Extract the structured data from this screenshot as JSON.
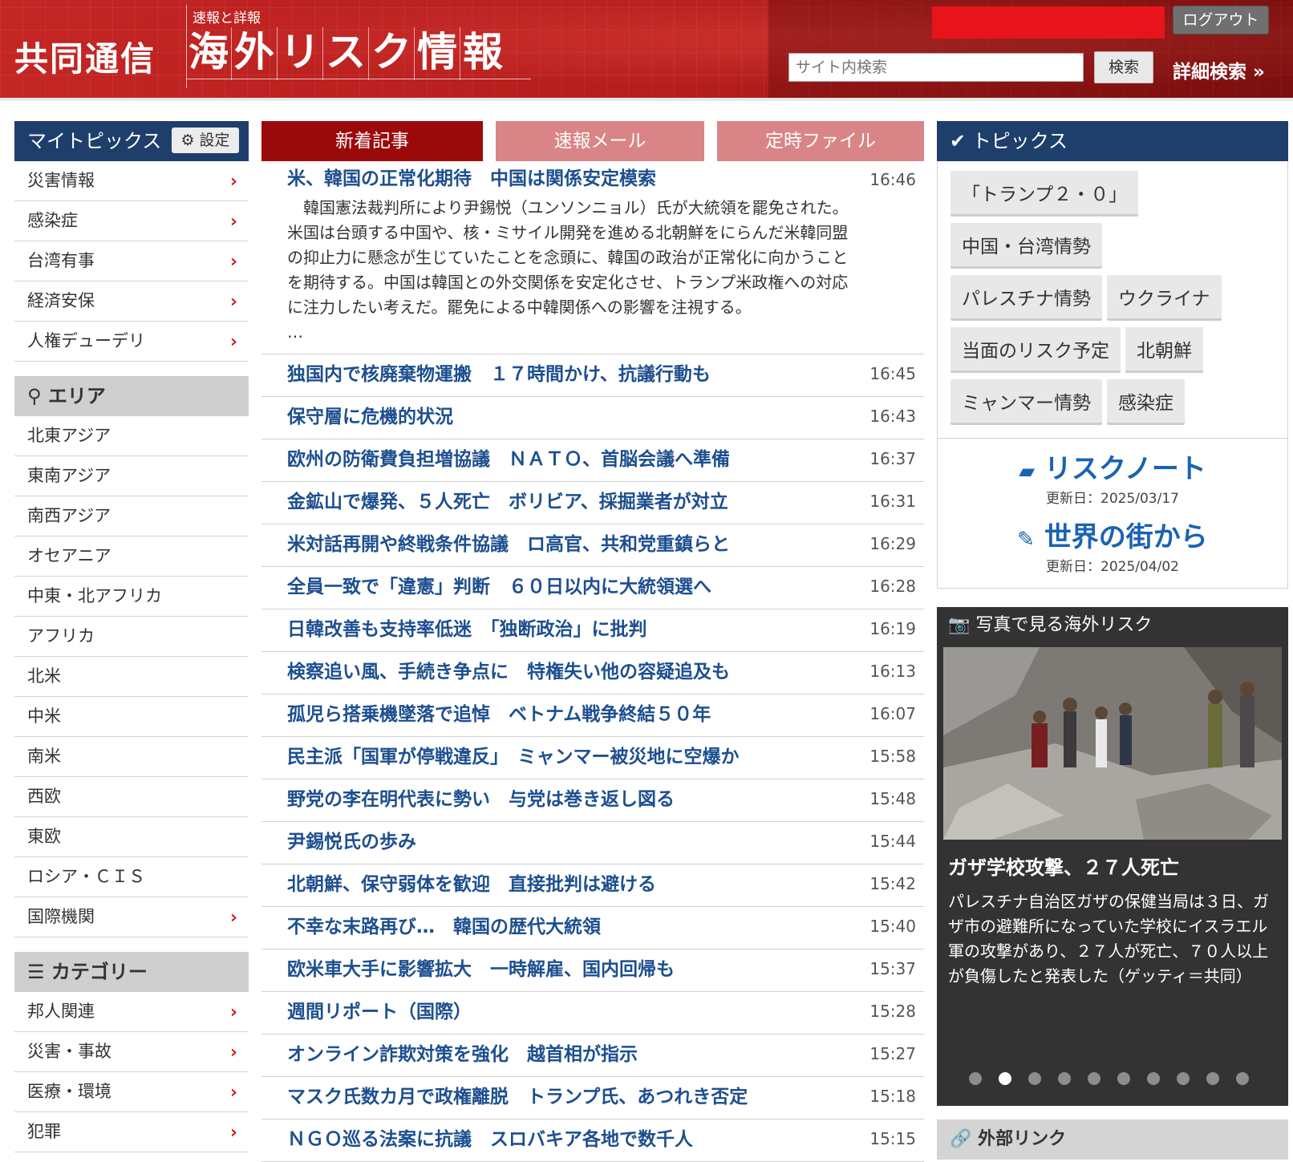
{
  "header": {
    "brand": "共同通信",
    "subtitle": "速報と詳報",
    "title_chars": [
      "海",
      "外",
      "リ",
      "ス",
      "ク",
      "情",
      "報"
    ],
    "logout_label": "ログアウト",
    "search_placeholder": "サイト内検索",
    "search_button": "検索",
    "advanced_search": "詳細検索 »"
  },
  "my_topics": {
    "title": "マイトピックス",
    "settings_label": "設定",
    "items": [
      {
        "label": "災害情報",
        "chev": "›"
      },
      {
        "label": "感染症",
        "chev": "›"
      },
      {
        "label": "台湾有事",
        "chev": "›"
      },
      {
        "label": "経済安保",
        "chev": "›"
      },
      {
        "label": "人権デューデリ",
        "chev": "›"
      }
    ]
  },
  "area": {
    "title": "エリア",
    "items": [
      {
        "label": "北東アジア",
        "chev": ""
      },
      {
        "label": "東南アジア",
        "chev": ""
      },
      {
        "label": "南西アジア",
        "chev": ""
      },
      {
        "label": "オセアニア",
        "chev": ""
      },
      {
        "label": "中東・北アフリカ",
        "chev": ""
      },
      {
        "label": "アフリカ",
        "chev": ""
      },
      {
        "label": "北米",
        "chev": ""
      },
      {
        "label": "中米",
        "chev": ""
      },
      {
        "label": "南米",
        "chev": ""
      },
      {
        "label": "西欧",
        "chev": ""
      },
      {
        "label": "東欧",
        "chev": ""
      },
      {
        "label": "ロシア・ＣＩＳ",
        "chev": ""
      },
      {
        "label": "国際機関",
        "chev": "›"
      }
    ]
  },
  "category": {
    "title": "カテゴリー",
    "items": [
      {
        "label": "邦人関連",
        "chev": "›"
      },
      {
        "label": "災害・事故",
        "chev": "›"
      },
      {
        "label": "医療・環境",
        "chev": "›"
      },
      {
        "label": "犯罪",
        "chev": "›"
      }
    ]
  },
  "tabs": {
    "new": "新着記事",
    "mail": "速報メール",
    "file": "定時ファイル"
  },
  "feature": {
    "title": "米、韓国の正常化期待　中国は関係安定模索",
    "time": "16:46",
    "body": "　韓国憲法裁判所により尹錫悦（ユンソンニョル）氏が大統領を罷免された。米国は台頭する中国や、核・ミサイル開発を進める北朝鮮をにらんだ米韓同盟の抑止力に懸念が生じていたことを念頭に、韓国の政治が正常化に向かうことを期待する。中国は韓国との外交関係を安定化させ、トランプ米政権への対応に注力したい考えだ。罷免による中韓関係への影響を注視する。\n…"
  },
  "news": [
    {
      "title": "独国内で核廃棄物運搬　１７時間かけ、抗議行動も",
      "time": "16:45"
    },
    {
      "title": "保守層に危機的状況",
      "time": "16:43"
    },
    {
      "title": "欧州の防衛費負担増協議　ＮＡＴＯ、首脳会議へ準備",
      "time": "16:37"
    },
    {
      "title": "金鉱山で爆発、５人死亡　ボリビア、採掘業者が対立",
      "time": "16:31"
    },
    {
      "title": "米対話再開や終戦条件協議　ロ高官、共和党重鎮らと",
      "time": "16:29"
    },
    {
      "title": "全員一致で「違憲」判断　６０日以内に大統領選へ",
      "time": "16:28"
    },
    {
      "title": "日韓改善も支持率低迷　「独断政治」に批判",
      "time": "16:19"
    },
    {
      "title": "検察追い風、手続き争点に　特権失い他の容疑追及も",
      "time": "16:13"
    },
    {
      "title": "孤児ら搭乗機墜落で追悼　ベトナム戦争終結５０年",
      "time": "16:07"
    },
    {
      "title": "民主派「国軍が停戦違反」　ミャンマー被災地に空爆か",
      "time": "15:58"
    },
    {
      "title": "野党の李在明代表に勢い　与党は巻き返し図る",
      "time": "15:48"
    },
    {
      "title": "尹錫悦氏の歩み",
      "time": "15:44"
    },
    {
      "title": "北朝鮮、保守弱体を歓迎　直接批判は避ける",
      "time": "15:42"
    },
    {
      "title": "不幸な末路再び…　韓国の歴代大統領",
      "time": "15:40"
    },
    {
      "title": "欧米車大手に影響拡大　一時解雇、国内回帰も",
      "time": "15:37"
    },
    {
      "title": "週間リポート（国際）",
      "time": "15:28"
    },
    {
      "title": "オンライン詐欺対策を強化　越首相が指示",
      "time": "15:27"
    },
    {
      "title": "マスク氏数カ月で政権離脱　トランプ氏、あつれき否定",
      "time": "15:18"
    },
    {
      "title": "ＮＧＯ巡る法案に抗議　スロバキア各地で数千人",
      "time": "15:15"
    }
  ],
  "topics": {
    "title": "トピックス",
    "chips": [
      "「トランプ２・０」",
      "中国・台湾情勢",
      "パレスチナ情勢",
      "ウクライナ",
      "当面のリスク予定",
      "北朝鮮",
      "ミャンマー情勢",
      "感染症"
    ],
    "risk_note": {
      "title": "リスクノート",
      "date": "更新日：2025/03/17"
    },
    "world_city": {
      "title": "世界の街から",
      "date": "更新日：2025/04/02"
    }
  },
  "photo": {
    "title": "写真で見る海外リスク",
    "caption_title": "ガザ学校攻撃、２７人死亡",
    "caption": "パレスチナ自治区ガザの保健当局は３日、ガザ市の避難所になっていた学校にイスラエル軍の攻撃があり、２７人が死亡、７０人以上が負傷したと発表した（ゲッティ＝共同）",
    "slide_count": 10,
    "active_slide": 2
  },
  "external_links": {
    "title": "外部リンク"
  },
  "colors": {
    "header_red": "#b5201f",
    "nav_blue": "#1e3e6c",
    "link_blue": "#1d4f8f",
    "tab_active": "#9b0a0a",
    "tab_inactive": "#d98486",
    "chevron_red": "#c52424"
  }
}
